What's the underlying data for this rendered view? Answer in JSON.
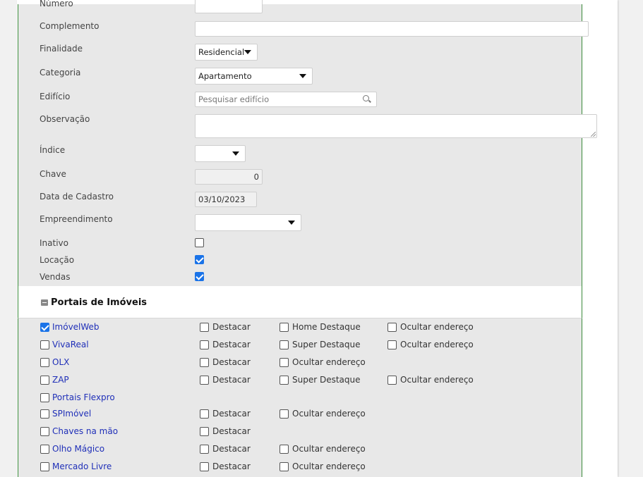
{
  "form": {
    "numero": {
      "label": "Número"
    },
    "complemento": {
      "label": "Complemento",
      "value": ""
    },
    "finalidade": {
      "label": "Finalidade",
      "value": "Residencial"
    },
    "categoria": {
      "label": "Categoria",
      "value": "Apartamento"
    },
    "edificio": {
      "label": "Edifício",
      "placeholder": "Pesquisar edifício"
    },
    "observacao": {
      "label": "Observação"
    },
    "indice": {
      "label": "Índice",
      "value": ""
    },
    "chave": {
      "label": "Chave",
      "value": "0"
    },
    "data_cadastro": {
      "label": "Data de Cadastro",
      "value": "03/10/2023"
    },
    "empreendimento": {
      "label": "Empreendimento",
      "value": ""
    },
    "inativo": {
      "label": "Inativo",
      "checked": false
    },
    "locacao": {
      "label": "Locação",
      "checked": true
    },
    "vendas": {
      "label": "Vendas",
      "checked": true
    }
  },
  "portais": {
    "title": "Portais de Imóveis",
    "items": [
      {
        "name": "ImóvelWeb",
        "checked": true,
        "options": [
          "Destacar",
          "Home Destaque",
          "Ocultar endereço"
        ]
      },
      {
        "name": "VivaReal",
        "checked": false,
        "options": [
          "Destacar",
          "Super Destaque",
          "Ocultar endereço"
        ]
      },
      {
        "name": "OLX",
        "checked": false,
        "options": [
          "Destacar",
          "Ocultar endereço"
        ]
      },
      {
        "name": "ZAP",
        "checked": false,
        "options": [
          "Destacar",
          "Super Destaque",
          "Ocultar endereço"
        ]
      },
      {
        "name": "Portais Flexpro",
        "checked": false,
        "options": []
      },
      {
        "name": "SPImóvel",
        "checked": false,
        "options": [
          "Destacar",
          "Ocultar endereço"
        ]
      },
      {
        "name": "Chaves na mão",
        "checked": false,
        "options": [
          "Destacar"
        ]
      },
      {
        "name": "Olho Mágico",
        "checked": false,
        "options": [
          "Destacar",
          "Ocultar endereço"
        ]
      },
      {
        "name": "Mercado Livre",
        "checked": false,
        "options": [
          "Destacar",
          "Ocultar endereço"
        ]
      }
    ]
  }
}
